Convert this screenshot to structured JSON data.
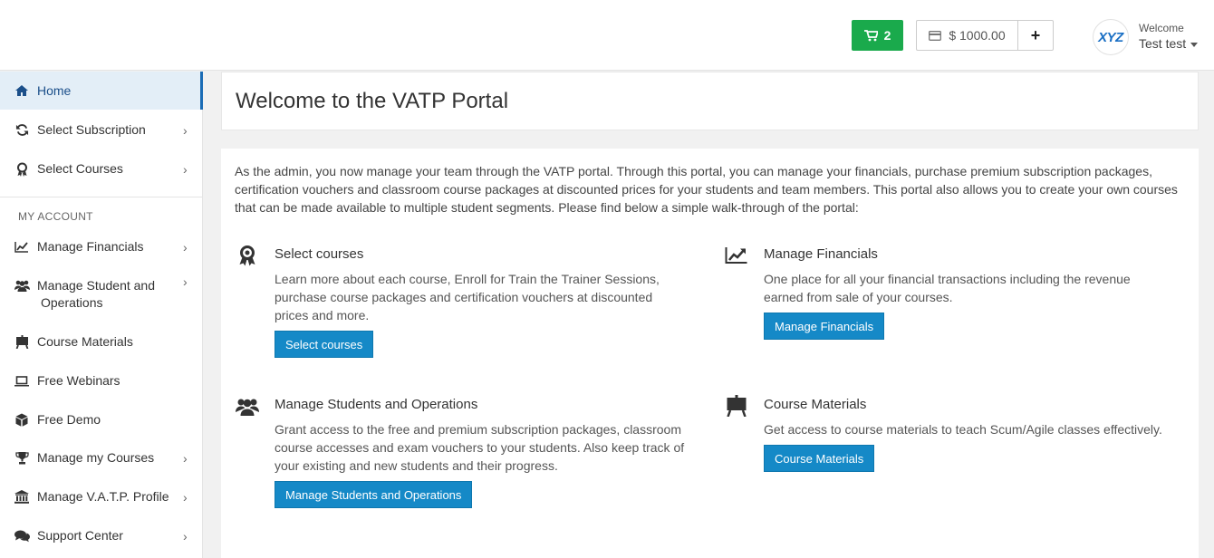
{
  "header": {
    "cart_count": "2",
    "balance": "$ 1000.00",
    "add_funds_label": "+",
    "logo_text": "XYZ",
    "welcome_label": "Welcome",
    "user_name": "Test test"
  },
  "sidebar": {
    "items": [
      {
        "label": "Home",
        "icon": "home-icon"
      },
      {
        "label": "Select Subscription",
        "icon": "refresh-icon"
      },
      {
        "label": "Select Courses",
        "icon": "award-icon"
      },
      {
        "label": "Manage Financials",
        "icon": "line-chart-icon"
      },
      {
        "label": "Manage Student and",
        "label2": "Operations",
        "icon": "users-icon"
      },
      {
        "label": "Course Materials",
        "icon": "easel-icon"
      },
      {
        "label": "Free Webinars",
        "icon": "laptop-icon"
      },
      {
        "label": "Free Demo",
        "icon": "cube-icon"
      },
      {
        "label": "Manage my Courses",
        "icon": "trophy-icon"
      },
      {
        "label": "Manage V.A.T.P. Profile",
        "icon": "bank-icon"
      },
      {
        "label": "Support Center",
        "icon": "comments-icon"
      }
    ],
    "section_label": "MY ACCOUNT"
  },
  "main": {
    "title": "Welcome to the VATP Portal",
    "intro": "As the admin, you now manage your team through the VATP portal. Through this portal, you can manage your financials, purchase premium subscription packages, certification vouchers and classroom course packages at discounted prices for your students and team members. This portal also allows you to create your own courses that can be made available to multiple student segments. Please find below a simple walk-through of the portal:",
    "features": [
      {
        "title": "Select courses",
        "desc": "Learn more about each course, Enroll for Train the Trainer Sessions, purchase course packages and certification vouchers at discounted prices and more.",
        "button": "Select courses"
      },
      {
        "title": "Manage Financials",
        "desc": "One place for all your financial transactions including the revenue earned from sale of your courses.",
        "button": "Manage Financials"
      },
      {
        "title": "Manage Students and Operations",
        "desc": "Grant access to the free and premium subscription packages, classroom course accesses and exam vouchers to your students. Also keep track of your existing and new students and their progress.",
        "button": "Manage Students and Operations"
      },
      {
        "title": "Course Materials",
        "desc": "Get access to course materials to teach Scum/Agile classes effectively.",
        "button": "Course Materials"
      }
    ]
  },
  "colors": {
    "cart_green": "#1aaa4c",
    "primary_blue": "#1589c7",
    "active_nav_bg": "#e3eef7"
  }
}
